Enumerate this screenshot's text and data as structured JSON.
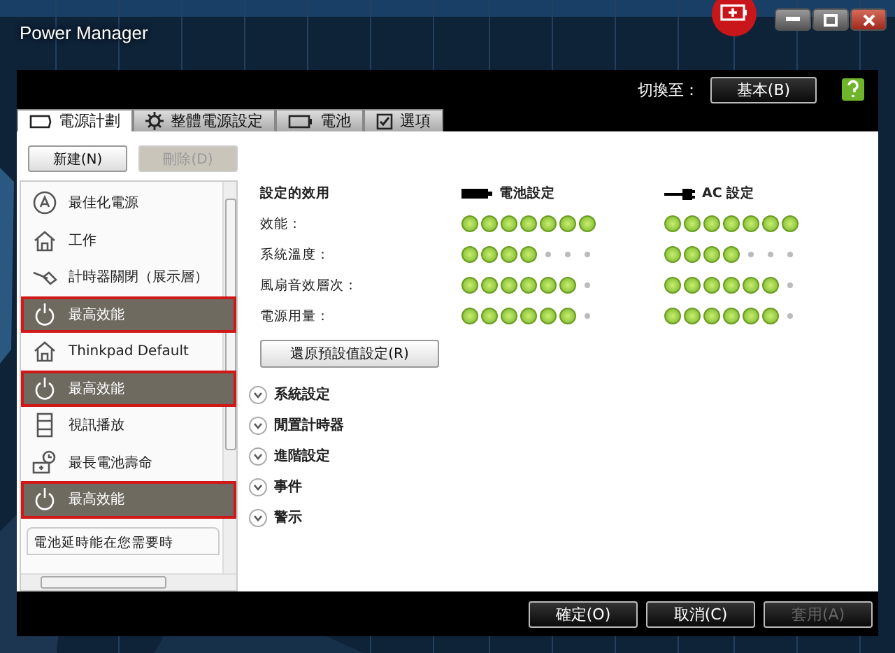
{
  "window": {
    "title": "Power Manager"
  },
  "header": {
    "switch_label": "切換至：",
    "switch_button": "基本(B)"
  },
  "tabs": [
    {
      "label": "電源計劃",
      "selected": true
    },
    {
      "label": "整體電源設定",
      "selected": false
    },
    {
      "label": "電池",
      "selected": false
    },
    {
      "label": "選項",
      "selected": false
    }
  ],
  "plan_buttons": [
    {
      "label": "新建(N)",
      "disabled": false
    },
    {
      "label": "刪除(D)",
      "disabled": true
    }
  ],
  "plans": [
    {
      "name": "最佳化電源",
      "kind": "auto",
      "highlighted": false
    },
    {
      "name": "工作",
      "kind": "house",
      "highlighted": false
    },
    {
      "name": "計時器關閉（展示層）",
      "kind": "tag",
      "highlighted": false
    },
    {
      "name": "最高效能",
      "kind": "power",
      "highlighted": true
    },
    {
      "name": "Thinkpad Default",
      "kind": "house",
      "highlighted": false
    },
    {
      "name": "最高效能",
      "kind": "power",
      "highlighted": true
    },
    {
      "name": "視訊播放",
      "kind": "film",
      "highlighted": false
    },
    {
      "name": "最長電池壽命",
      "kind": "clock",
      "highlighted": false
    },
    {
      "name": "最高效能",
      "kind": "power",
      "highlighted": true
    }
  ],
  "tip": {
    "text": "電池延時能在您需要時"
  },
  "effects": {
    "title": "設定的效用",
    "battery_heading": "電池設定",
    "ac_heading": "AC 設定",
    "rows": [
      {
        "label": "效能：",
        "battery": {
          "stars": 7
        },
        "ac": {
          "stars": 7
        }
      },
      {
        "label": "系統溫度：",
        "battery": {
          "stars": 4
        },
        "ac": {
          "stars": 4
        }
      },
      {
        "label": "風扇音效層次：",
        "battery": {
          "stars": 6
        },
        "ac": {
          "stars": 6
        }
      },
      {
        "label": "電源用量：",
        "battery": {
          "stars": 6
        },
        "ac": {
          "stars": 6
        }
      }
    ]
  },
  "restore_button": "還原預設值設定(R)",
  "sections": [
    {
      "label": "系統設定",
      "expanded": false
    },
    {
      "label": "閒置計時器",
      "expanded": false
    },
    {
      "label": "進階設定",
      "expanded": false
    },
    {
      "label": "事件",
      "expanded": false
    },
    {
      "label": "警示",
      "expanded": false
    }
  ],
  "footer_buttons": [
    {
      "label": "確定(O)",
      "disabled": false
    },
    {
      "label": "取消(C)",
      "disabled": false
    },
    {
      "label": "套用(A)",
      "disabled": true
    }
  ]
}
